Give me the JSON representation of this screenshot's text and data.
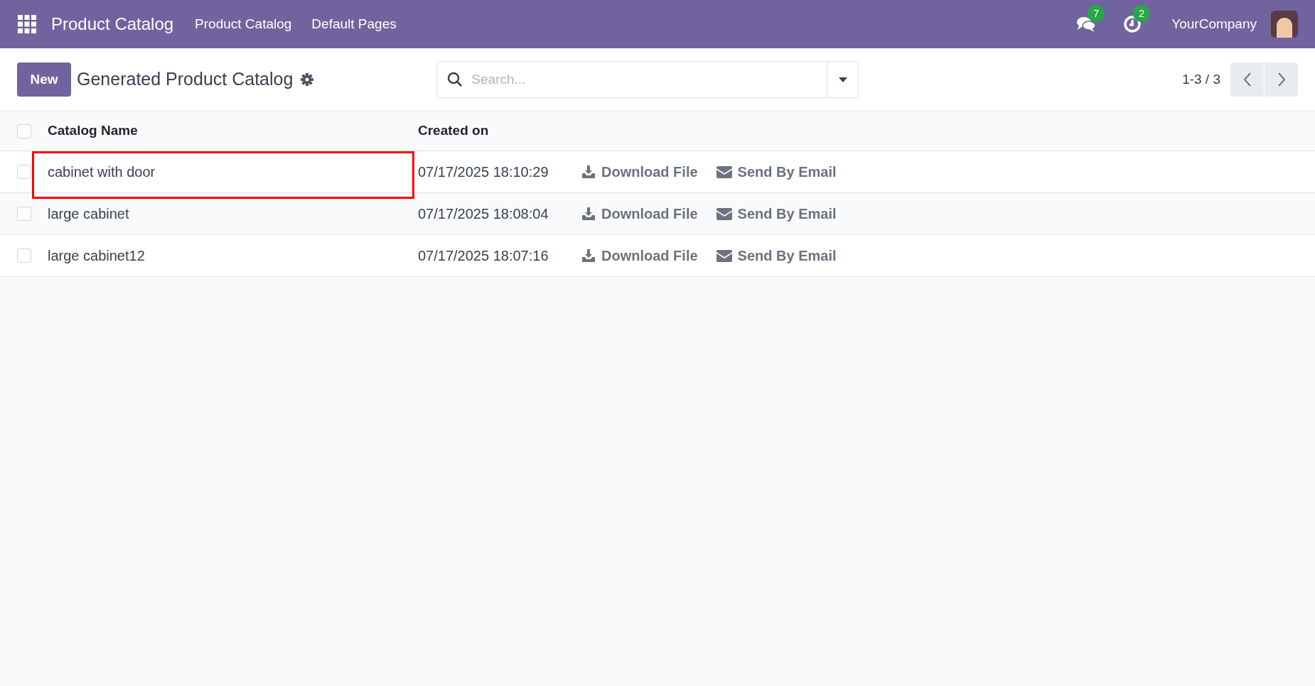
{
  "navbar": {
    "app_title": "Product Catalog",
    "menu": [
      "Product Catalog",
      "Default Pages"
    ],
    "messages_count": "7",
    "activities_count": "2",
    "company": "YourCompany"
  },
  "control_panel": {
    "new_button": "New",
    "title": "Generated Product Catalog",
    "search": {
      "placeholder": "Search..."
    },
    "pager": "1-3 / 3"
  },
  "table": {
    "select_all_checked": false,
    "columns": [
      "Catalog Name",
      "Created on"
    ],
    "rows": [
      {
        "name": "cabinet with door",
        "created_on": "07/17/2025 18:10:29",
        "download": "Download File",
        "email": "Send By Email",
        "checked": false,
        "highlighted": true
      },
      {
        "name": "large cabinet",
        "created_on": "07/17/2025 18:08:04",
        "download": "Download File",
        "email": "Send By Email",
        "checked": false,
        "highlighted": false
      },
      {
        "name": "large cabinet12",
        "created_on": "07/17/2025 18:07:16",
        "download": "Download File",
        "email": "Send By Email",
        "checked": false,
        "highlighted": false
      }
    ]
  }
}
